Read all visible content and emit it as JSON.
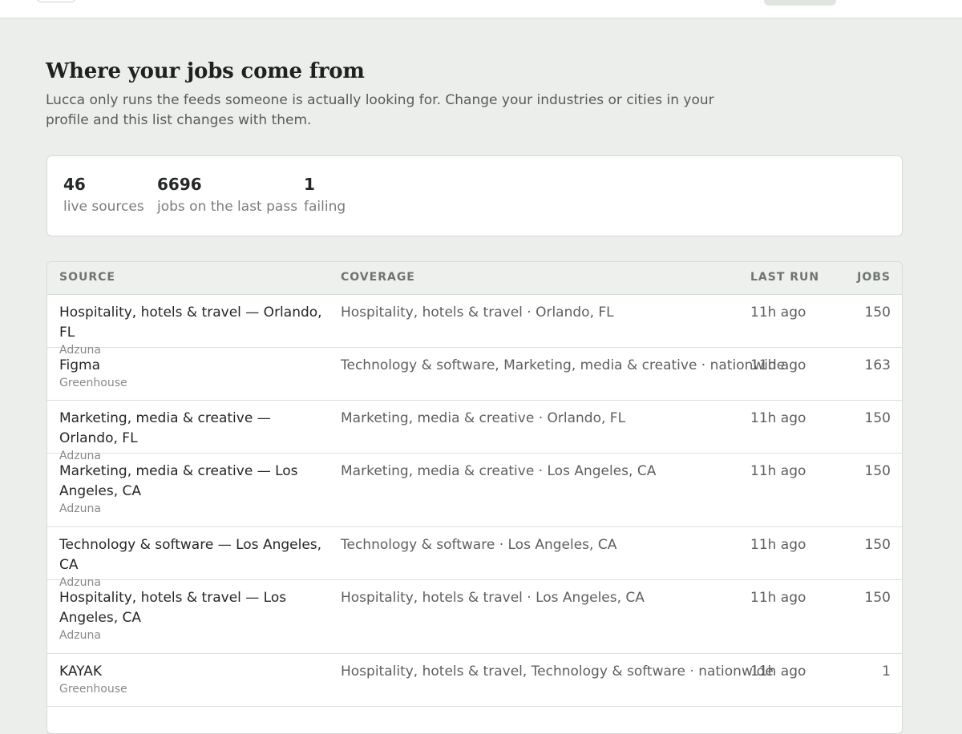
{
  "page": {
    "title": "Where your jobs come from",
    "intro": "Lucca only runs the feeds someone is actually looking for. Change your industries or cities in your profile and this list changes with them."
  },
  "stats": [
    {
      "value": "46",
      "label": "live sources"
    },
    {
      "value": "6696",
      "label": "jobs on the last pass"
    },
    {
      "value": "1",
      "label": "failing"
    }
  ],
  "table": {
    "headers": {
      "source": "SOURCE",
      "coverage": "COVERAGE",
      "last_run": "LAST RUN",
      "jobs": "JOBS"
    },
    "rows": [
      {
        "source": "Hospitality, hotels & travel — Orlando, FL",
        "provider": "Adzuna",
        "coverage": "Hospitality, hotels & travel · Orlando, FL",
        "last_run": "11h ago",
        "jobs": "150"
      },
      {
        "source": "Figma",
        "provider": "Greenhouse",
        "coverage": "Technology & software, Marketing, media & creative · nationwide",
        "last_run": "11h ago",
        "jobs": "163"
      },
      {
        "source": "Marketing, media & creative — Orlando, FL",
        "provider": "Adzuna",
        "coverage": "Marketing, media & creative · Orlando, FL",
        "last_run": "11h ago",
        "jobs": "150"
      },
      {
        "source": "Marketing, media & creative — Los Angeles, CA",
        "provider": "Adzuna",
        "coverage": "Marketing, media & creative · Los Angeles, CA",
        "last_run": "11h ago",
        "jobs": "150"
      },
      {
        "source": "Technology & software — Los Angeles, CA",
        "provider": "Adzuna",
        "coverage": "Technology & software · Los Angeles, CA",
        "last_run": "11h ago",
        "jobs": "150"
      },
      {
        "source": "Hospitality, hotels & travel — Los Angeles, CA",
        "provider": "Adzuna",
        "coverage": "Hospitality, hotels & travel · Los Angeles, CA",
        "last_run": "11h ago",
        "jobs": "150"
      },
      {
        "source": "KAYAK",
        "provider": "Greenhouse",
        "coverage": "Hospitality, hotels & travel, Technology & software · nationwide",
        "last_run": "11h ago",
        "jobs": "1"
      }
    ]
  }
}
